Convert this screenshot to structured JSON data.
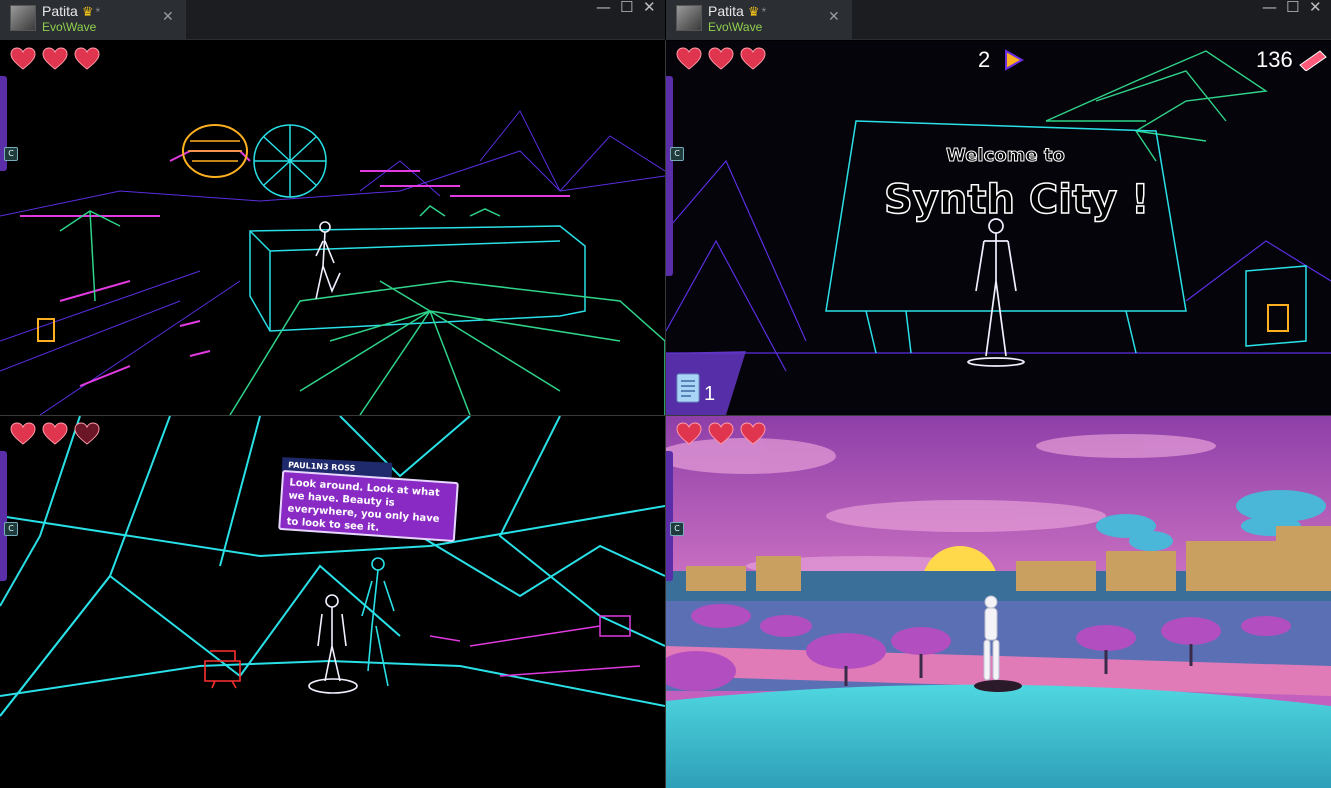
{
  "window_left": {
    "user_name": "Patita",
    "app_path": "Evo\\Wave",
    "badge_icon": "crown-bird-icon",
    "modified_marker": "*"
  },
  "window_right": {
    "user_name": "Patita",
    "app_path": "Evo\\Wave",
    "badge_icon": "crown-bird-icon",
    "modified_marker": "*"
  },
  "controls": {
    "minimize": "—",
    "maximize": "☐",
    "close": "✕",
    "tab_close": "✕"
  },
  "panels": {
    "top_left": {
      "hearts_full": 3,
      "hearts_total": 3,
      "c_button": "C"
    },
    "top_right": {
      "hearts_full": 3,
      "hearts_total": 3,
      "c_button": "C",
      "play_count": "2",
      "gem_count": "136",
      "sign_line1": "Welcome to",
      "sign_line2": "Synth City !",
      "doc_count": "1"
    },
    "bottom_left": {
      "hearts_full": 2,
      "hearts_total": 3,
      "c_button": "C",
      "speaker": "PAUL1N3 ROSS",
      "dialog": "Look around. Look at what we have. Beauty is everywhere, you only have to look to see it."
    },
    "bottom_right": {
      "hearts_full": 3,
      "hearts_total": 3,
      "c_button": "C"
    }
  },
  "colors": {
    "heart_full": "#e0354f",
    "heart_empty": "#6b1626",
    "neon_cyan": "#29e0e6",
    "neon_magenta": "#e03ae0",
    "neon_purple": "#5a2ee0",
    "neon_green": "#2fd38a",
    "sky_magenta": "#c25fbf",
    "water_cyan": "#3fc9d8"
  }
}
